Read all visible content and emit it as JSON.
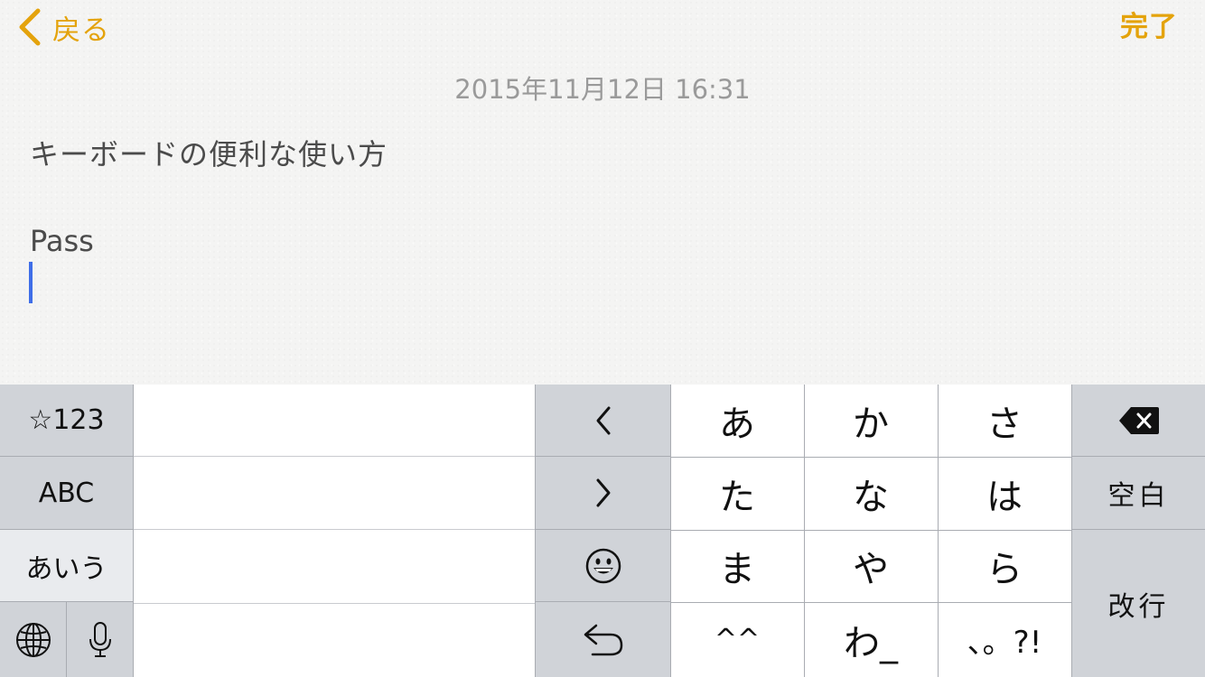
{
  "nav": {
    "back_label": "戻る",
    "done_label": "完了"
  },
  "note": {
    "timestamp": "2015年11月12日 16:31",
    "lines": [
      "キーボードの便利な使い方",
      "Pass"
    ]
  },
  "colors": {
    "accent": "#e4a30c",
    "caret": "#3f6ee8",
    "key_gray": "#d0d3d8",
    "key_white": "#ffffff"
  },
  "keyboard": {
    "mode_keys": [
      "☆123",
      "ABC",
      "あいう"
    ],
    "globe_icon": "globe-icon",
    "mic_icon": "microphone-icon",
    "left_arrow": "<",
    "right_arrow": ">",
    "emoji_icon": "smiley-icon",
    "undo_icon": "undo-icon",
    "kana_rows": [
      [
        "あ",
        "か",
        "さ"
      ],
      [
        "た",
        "な",
        "は"
      ],
      [
        "ま",
        "や",
        "ら"
      ],
      [
        "^^",
        "わ_",
        "、。?!"
      ]
    ],
    "delete_icon": "delete-icon",
    "space_label": "空白",
    "return_label": "改行"
  }
}
